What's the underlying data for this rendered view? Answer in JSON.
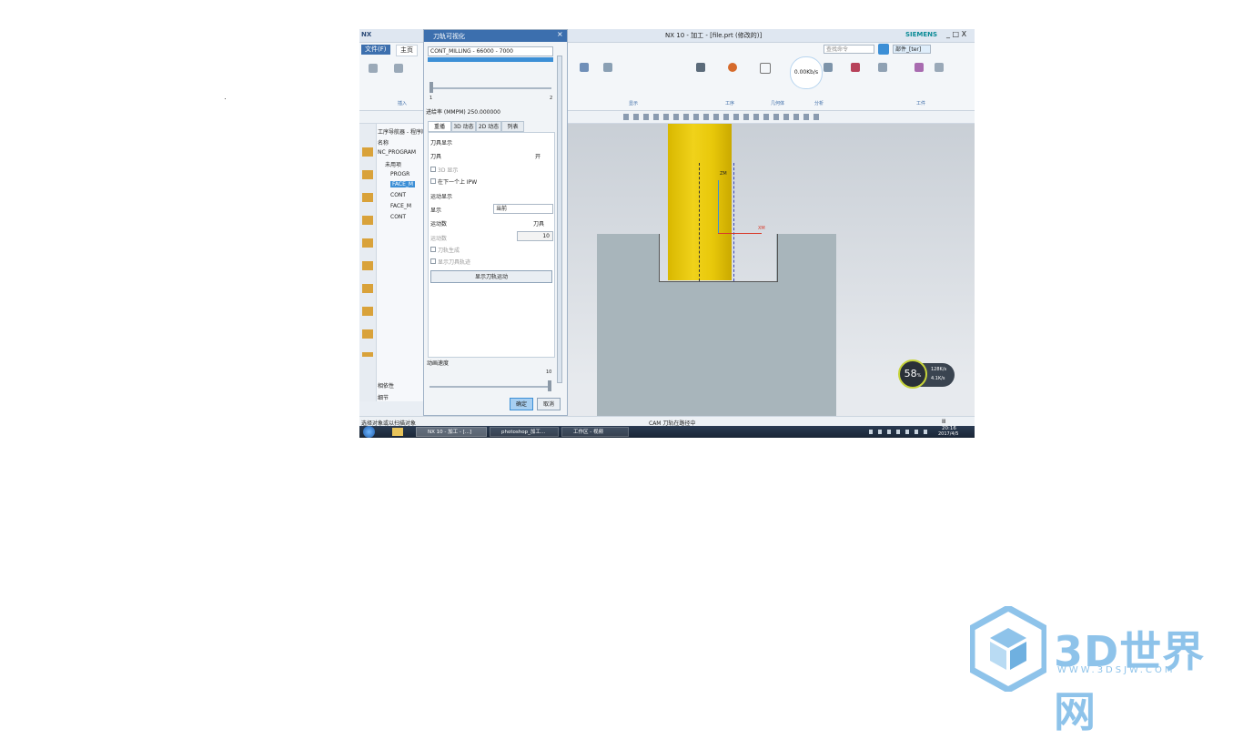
{
  "window": {
    "app_logo": "NX",
    "title": "NX 10 - 加工 - [file.prt (修改的)]",
    "brand": "SIEMENS",
    "controls": "_ □ X",
    "search_placeholder": "查找命令",
    "search_box": "部件_[ter]"
  },
  "ribbon": {
    "tabs": [
      "文件(F)",
      "主页"
    ],
    "group_labels": [
      "插入",
      "显示",
      "工序",
      "几何体",
      "分析",
      "工件"
    ],
    "speed_badge": "0.00Kb/s"
  },
  "navigator": {
    "header": "工序导航器 - 程序顺序",
    "column": "名称",
    "items": [
      "NC_PROGRAM",
      "未用项",
      "PROGR",
      "FACE_M",
      "CONT",
      "FACE_M",
      "CONT"
    ],
    "footer_items": [
      "相依性",
      "细节"
    ]
  },
  "dialog": {
    "title": "刀轨可视化",
    "list_row": "CONT_MILLING - 66000 - 7000",
    "slider_min": "1",
    "slider_max": "2",
    "feed_label": "进给率 (MMPM) 250.000000",
    "tabs": [
      "重播",
      "3D 动态",
      "2D 动态",
      "列表"
    ],
    "section_display": "刀具显示",
    "tool_label": "刀具",
    "tool_value": "开",
    "chk_3d": "3D 显示",
    "chk_update": "在下一个上 IPW",
    "section_motion": "运动显示",
    "display_label": "显示",
    "display_value": "当前",
    "mode_label": "运动数",
    "mode_value": "刀具",
    "count_label": "运动数",
    "count_value": "10",
    "chk_path": "刀轨生成",
    "chk_tool": "显示刀具轨迹",
    "button_path": "显示刀轨运动",
    "speed_label": "动画速度",
    "speed_max": "10",
    "ok": "确定",
    "cancel": "取消"
  },
  "viewport": {
    "axis_y": "ZM",
    "axis_x": "XM",
    "gauge_value": "58",
    "gauge_unit": "%",
    "gauge_up": "128K/s",
    "gauge_down": "4.1K/s"
  },
  "statusbar": {
    "left": "选择对象或以扫描对象",
    "middle": "CAM 刀轨在路径中",
    "right": "Ⅲ"
  },
  "taskbar": {
    "items": [
      "NX 10 - 加工 - [...]",
      "photoshop_加工...",
      "工作区 - 视频"
    ],
    "time": "20:16",
    "date": "2017/4/5"
  },
  "watermark": {
    "text": "3D世界网",
    "url": "WWW.3DSJW.COM"
  },
  "colors": {
    "accent": "#3c6fae",
    "tool_yellow": "#e8c80a",
    "part_gray": "#a8b5bb",
    "watermark": "#8ec3ea"
  }
}
